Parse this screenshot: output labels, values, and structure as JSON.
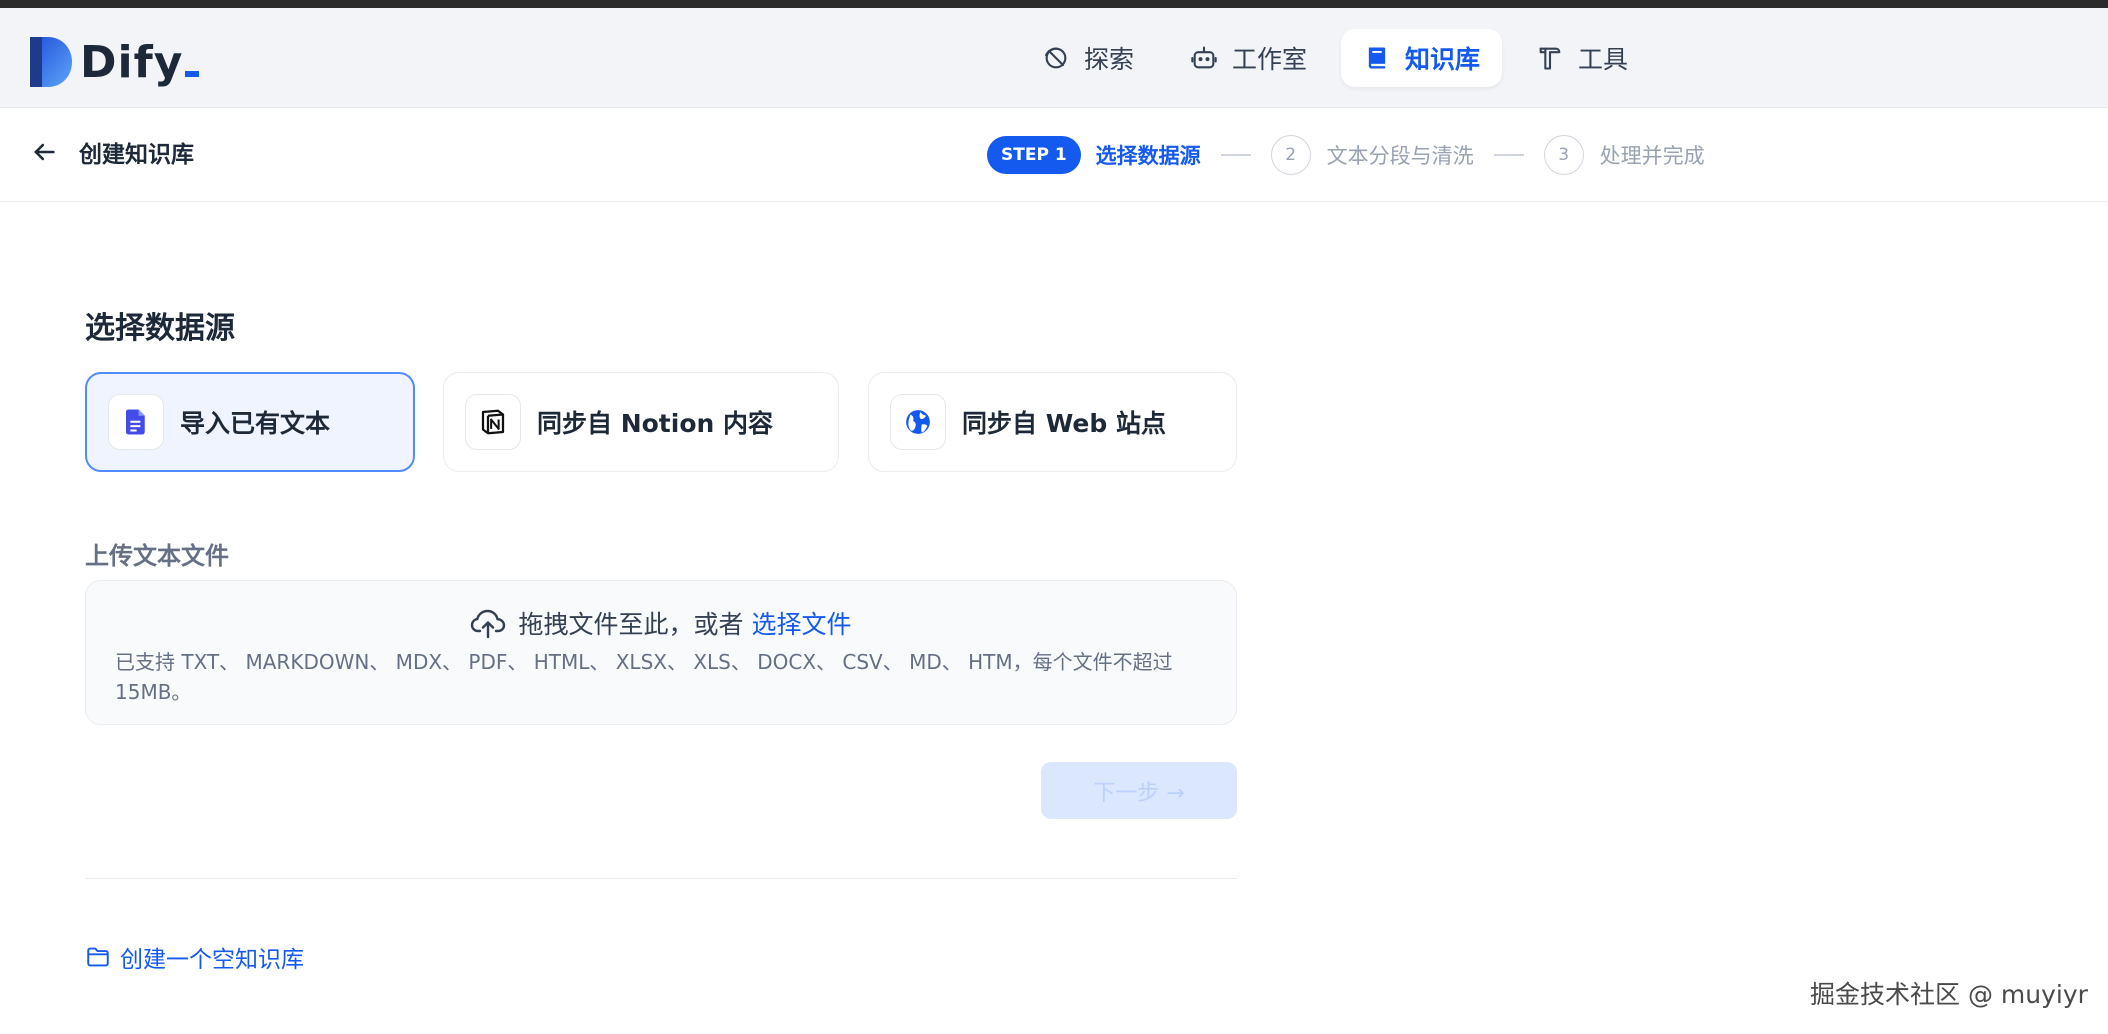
{
  "app": {
    "logo_text": "Dify"
  },
  "nav": [
    {
      "label": "探索",
      "icon": "explore-icon",
      "active": false
    },
    {
      "label": "工作室",
      "icon": "robot-icon",
      "active": false
    },
    {
      "label": "知识库",
      "icon": "book-icon",
      "active": true
    },
    {
      "label": "工具",
      "icon": "hammer-icon",
      "active": false
    }
  ],
  "subheader": {
    "title": "创建知识库",
    "steps": [
      {
        "badge": "STEP 1",
        "label": "选择数据源",
        "active": true
      },
      {
        "badge": "2",
        "label": "文本分段与清洗",
        "active": false
      },
      {
        "badge": "3",
        "label": "处理并完成",
        "active": false
      }
    ]
  },
  "main": {
    "section_title": "选择数据源",
    "sources": [
      {
        "label": "导入已有文本",
        "icon": "file-text-icon",
        "selected": true
      },
      {
        "label": "同步自 Notion 内容",
        "icon": "notion-icon",
        "selected": false
      },
      {
        "label": "同步自 Web 站点",
        "icon": "globe-icon",
        "selected": false
      }
    ],
    "upload_label": "上传文本文件",
    "dropzone": {
      "text": "拖拽文件至此，或者",
      "link": "选择文件",
      "hint": "已支持 TXT、 MARKDOWN、 MDX、 PDF、 HTML、 XLSX、 XLS、 DOCX、 CSV、 MD、 HTM，每个文件不超过 15MB。"
    },
    "next_button": "下一步 →",
    "create_empty": "创建一个空知识库"
  },
  "watermark": "掘金技术社区 @ muyiyr",
  "colors": {
    "accent": "#155aef",
    "selected_border": "#528bff",
    "selected_bg": "#eff4ff"
  }
}
